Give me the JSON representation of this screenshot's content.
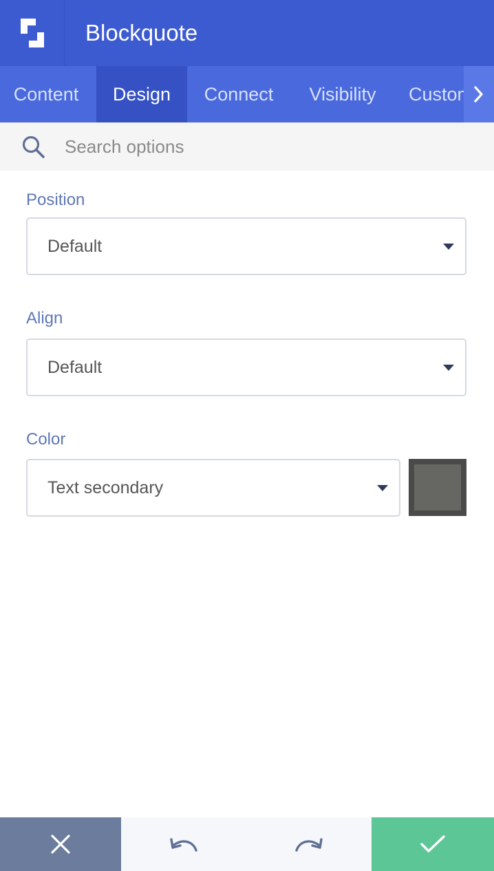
{
  "header": {
    "title": "Blockquote",
    "logo_icon": "yootheme-logo-icon"
  },
  "tabs": [
    {
      "label": "Content",
      "active": false
    },
    {
      "label": "Design",
      "active": true
    },
    {
      "label": "Connect",
      "active": false
    },
    {
      "label": "Visibility",
      "active": false
    },
    {
      "label": "Custom",
      "active": false
    }
  ],
  "search": {
    "placeholder": "Search options",
    "value": ""
  },
  "fields": {
    "position": {
      "label": "Position",
      "value": "Default"
    },
    "align": {
      "label": "Align",
      "value": "Default"
    },
    "color": {
      "label": "Color",
      "value": "Text secondary",
      "swatch_color": "#666663"
    }
  },
  "footer": {
    "cancel_icon": "close-icon",
    "undo_icon": "undo-icon",
    "redo_icon": "redo-icon",
    "confirm_icon": "checkmark-icon"
  },
  "colors": {
    "header_bg": "#3d5bd0",
    "tabs_bg": "#4a69dc",
    "active_tab_bg": "#3551c3",
    "label": "#5f77b8",
    "cancel_bg": "#6b7c9c",
    "confirm_bg": "#5dc697"
  }
}
